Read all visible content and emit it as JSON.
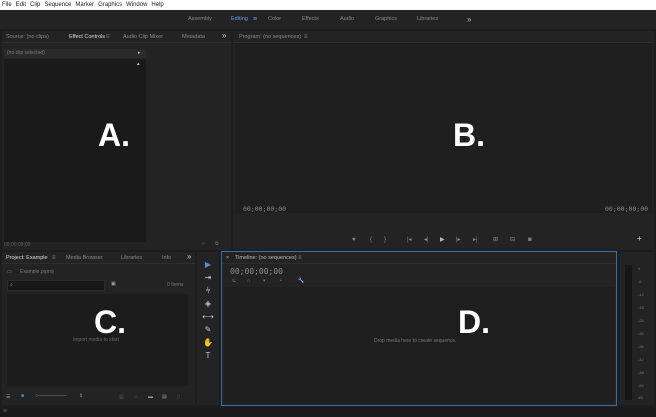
{
  "menu": [
    "File",
    "Edit",
    "Clip",
    "Sequence",
    "Marker",
    "Graphics",
    "Window",
    "Help"
  ],
  "workspaces": [
    "Assembly",
    "Editing",
    "Color",
    "Effects",
    "Audio",
    "Graphics",
    "Libraries"
  ],
  "source_panel": {
    "tabs": [
      "Source: (no clips)",
      "Effect Controls",
      "Audio Clip Mixer",
      "Metadata"
    ],
    "clip_header": "(no clip selected)",
    "timecode": "00;00;00;00",
    "label": "A."
  },
  "program_panel": {
    "title": "Program: (no sequences)",
    "timecode_left": "00;00;00;00",
    "timecode_right": "00;00;00;00",
    "label": "B."
  },
  "project_panel": {
    "tabs": [
      "Project: Example",
      "Media Browser",
      "Libraries",
      "Info"
    ],
    "file": "Example.prproj",
    "items": "0 Items",
    "empty_text": "Import media to start",
    "label": "C."
  },
  "timeline_panel": {
    "title": "Timeline: (no sequences)",
    "timecode": "00;00;00;00",
    "empty_text": "Drop media here to create sequence.",
    "label": "D."
  },
  "audio_meter": {
    "ticks": [
      "0",
      "-6",
      "-12",
      "-18",
      "-24",
      "-30",
      "-36",
      "-42",
      "-48",
      "-54",
      "dB"
    ]
  },
  "icons": {
    "overflow": "chevrons-right-icon",
    "panel_menu": "hamburger-icon",
    "search": "search-icon",
    "folder": "folder-icon"
  }
}
